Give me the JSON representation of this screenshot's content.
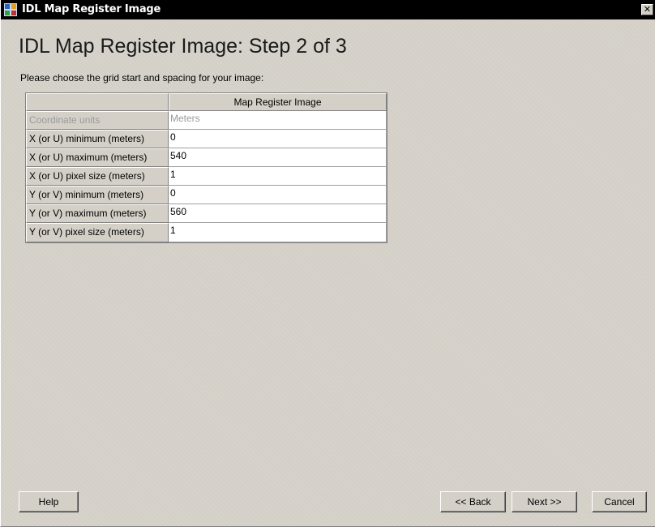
{
  "window": {
    "title": "IDL Map Register Image",
    "close_glyph": "✕"
  },
  "heading": "IDL Map Register Image: Step 2 of 3",
  "instruction": "Please choose the grid start and spacing for your image:",
  "grid": {
    "column_header": "Map Register Image",
    "rows": [
      {
        "label": "Coordinate units",
        "value": "Meters",
        "disabled": true
      },
      {
        "label": "X (or U) minimum (meters)",
        "value": "0",
        "disabled": false
      },
      {
        "label": "X (or U) maximum (meters)",
        "value": "540",
        "disabled": false
      },
      {
        "label": "X (or U) pixel size (meters)",
        "value": "1",
        "disabled": false
      },
      {
        "label": "Y (or V) minimum (meters)",
        "value": "0",
        "disabled": false
      },
      {
        "label": "Y (or V) maximum (meters)",
        "value": "560",
        "disabled": false
      },
      {
        "label": "Y (or V) pixel size (meters)",
        "value": "1",
        "disabled": false
      }
    ]
  },
  "buttons": {
    "help": "Help",
    "back": "<< Back",
    "next": "Next >>",
    "cancel": "Cancel"
  },
  "icons": {
    "app_icon": "idl-app-icon",
    "close": "close-icon"
  },
  "colors": {
    "titlebar": "#000000",
    "dialog_bg": "#d4d0c8",
    "disabled_text": "#9a9a9a"
  }
}
